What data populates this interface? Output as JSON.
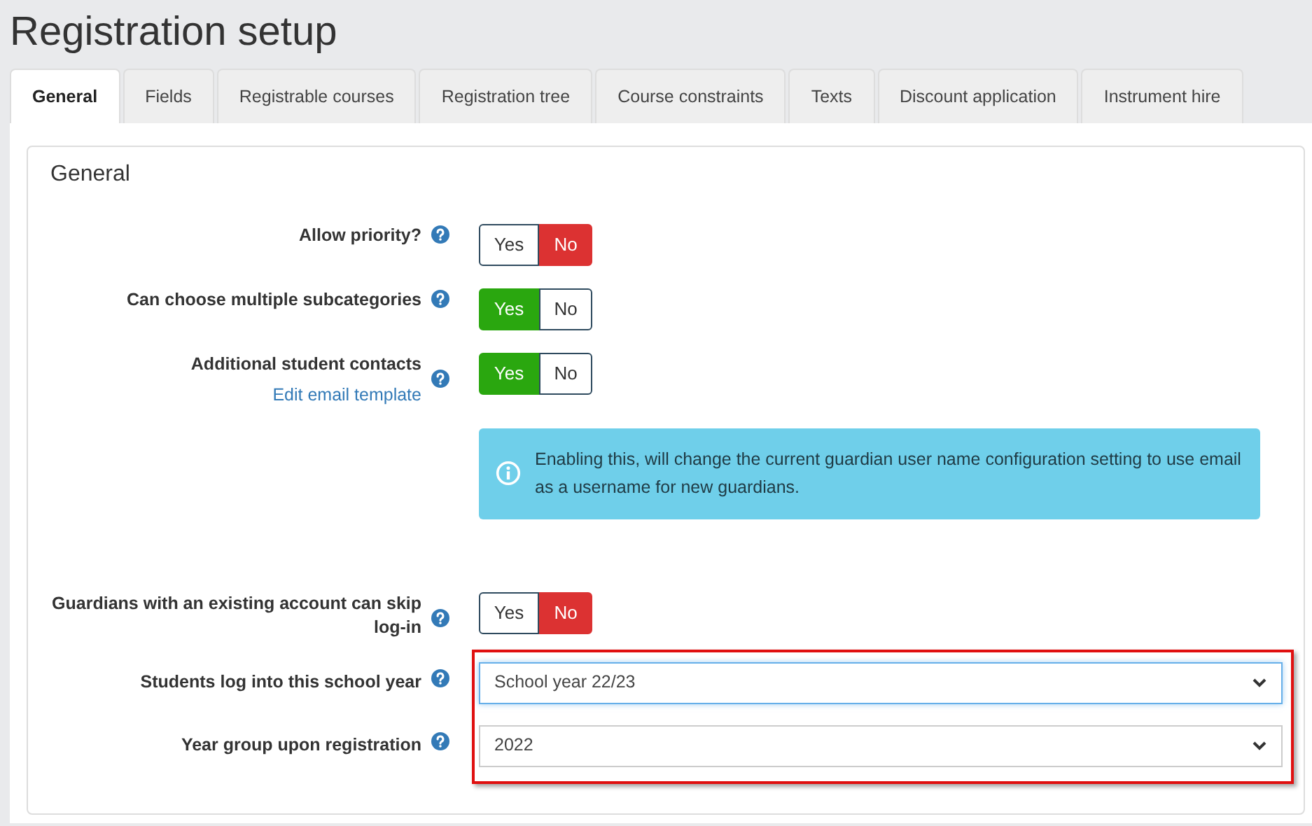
{
  "page_title": "Registration setup",
  "tabs": [
    {
      "label": "General",
      "selected": true
    },
    {
      "label": "Fields",
      "selected": false
    },
    {
      "label": "Registrable courses",
      "selected": false
    },
    {
      "label": "Registration tree",
      "selected": false
    },
    {
      "label": "Course constraints",
      "selected": false
    },
    {
      "label": "Texts",
      "selected": false
    },
    {
      "label": "Discount application",
      "selected": false
    },
    {
      "label": "Instrument hire",
      "selected": false
    }
  ],
  "section_title": "General",
  "rows": [
    {
      "kind": "toggle",
      "label": "Allow priority?",
      "yes": "Yes",
      "no": "No",
      "on": false
    },
    {
      "kind": "toggle",
      "label": "Can choose multiple subcategories",
      "yes": "Yes",
      "no": "No",
      "on": true
    },
    {
      "kind": "toggle",
      "label": "Additional student contacts",
      "link": "Edit email template",
      "yes": "Yes",
      "no": "No",
      "on": true
    },
    {
      "kind": "alert",
      "text": "Enabling this, will change the current guardian user name configuration setting to use email as a username for new guardians."
    },
    {
      "kind": "toggle",
      "label": "Guardians with an existing account can skip log-in",
      "yes": "Yes",
      "no": "No",
      "on": false
    }
  ],
  "highlighted_rows": [
    {
      "kind": "select",
      "label": "Students log into this school year",
      "value": "School year 22/23",
      "focused": true
    },
    {
      "kind": "select",
      "label": "Year group upon registration",
      "value": "2022",
      "focused": false
    }
  ]
}
